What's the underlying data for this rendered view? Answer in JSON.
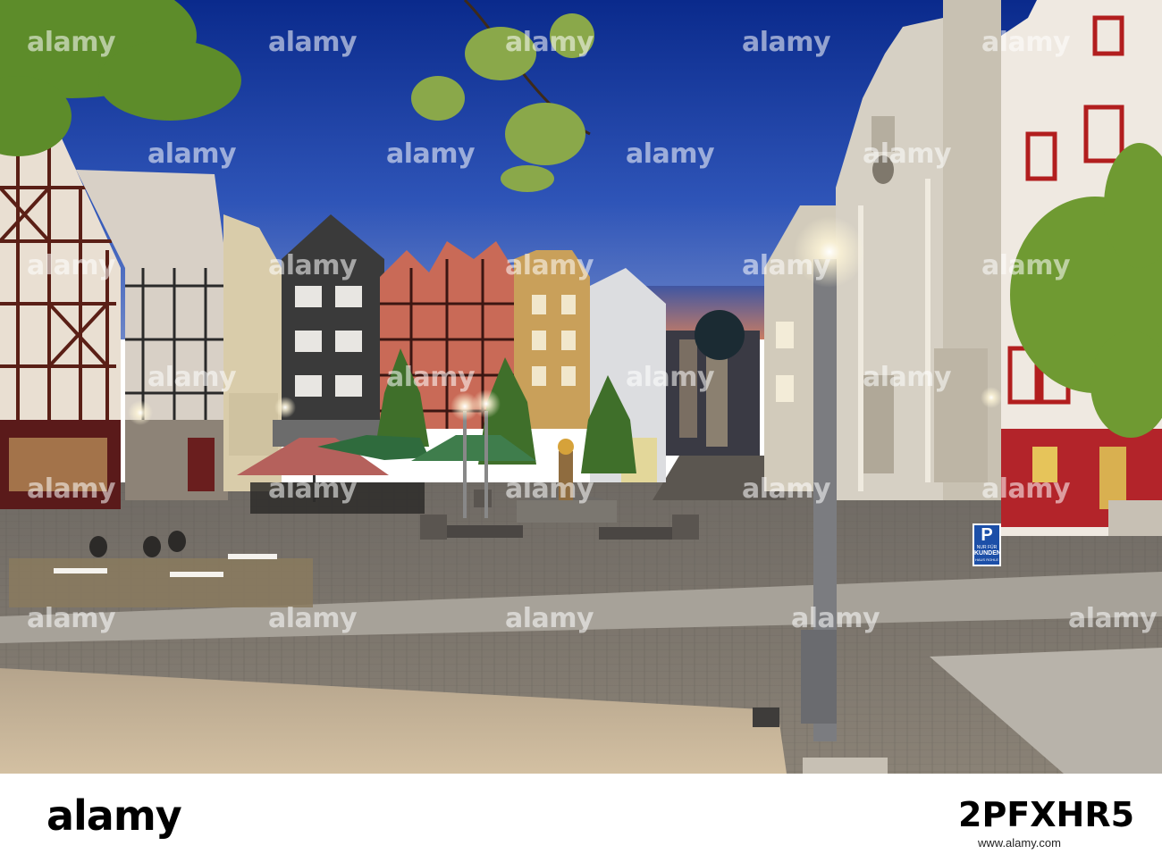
{
  "scene": {
    "description_colors": {
      "sky_top": "#0a2a8c",
      "sky_bottom": "#5a7cc9",
      "pavement": "#7e786f",
      "lamp_glow": "#fff6d8"
    }
  },
  "signs": {
    "parking_letter": "P",
    "parking_line1": "NUR FÜR",
    "parking_line2": "KUNDEN",
    "parking_line3": "HAUS ROHLE"
  },
  "watermark": {
    "text": "alamy",
    "text_bottom": "alamy"
  },
  "footer": {
    "logo": "alamy",
    "image_id": "2PFXHR5",
    "site": "www.alamy.com"
  }
}
